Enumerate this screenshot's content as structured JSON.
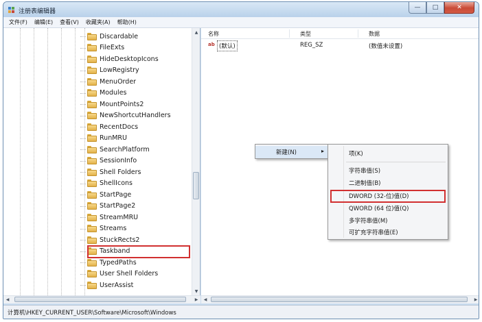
{
  "window": {
    "title": "注册表编辑器",
    "controls": {
      "minimize": "—",
      "maximize": "□",
      "close": "✕"
    }
  },
  "menubar": {
    "items": [
      "文件(F)",
      "编辑(E)",
      "查看(V)",
      "收藏夹(A)",
      "帮助(H)"
    ]
  },
  "tree": {
    "items": [
      "Discardable",
      "FileExts",
      "HideDesktopIcons",
      "LowRegistry",
      "MenuOrder",
      "Modules",
      "MountPoints2",
      "NewShortcutHandlers",
      "RecentDocs",
      "RunMRU",
      "SearchPlatform",
      "SessionInfo",
      "Shell Folders",
      "ShellIcons",
      "StartPage",
      "StartPage2",
      "StreamMRU",
      "Streams",
      "StuckRects2",
      "Taskband",
      "TypedPaths",
      "User Shell Folders",
      "UserAssist"
    ],
    "highlighted": "Taskband"
  },
  "list": {
    "columns": {
      "name": "名称",
      "type": "类型",
      "data": "数据"
    },
    "rows": [
      {
        "icon": "ab",
        "name": "(默认)",
        "type": "REG_SZ",
        "data": "(数值未设置)"
      }
    ]
  },
  "context_menu": {
    "new_label": "新建(N)",
    "arrow": "▸"
  },
  "submenu": {
    "items": [
      "项(K)",
      "字符串值(S)",
      "二进制值(B)",
      "DWORD (32-位)值(D)",
      "QWORD (64 位)值(Q)",
      "多字符串值(M)",
      "可扩充字符串值(E)"
    ],
    "highlighted": "DWORD (32-位)值(D)"
  },
  "statusbar": {
    "path": "计算机\\HKEY_CURRENT_USER\\Software\\Microsoft\\Windows"
  },
  "colors": {
    "highlight_box": "#d12f2f",
    "folder": "#e3b24a",
    "title_bar": "#c9dcef"
  }
}
